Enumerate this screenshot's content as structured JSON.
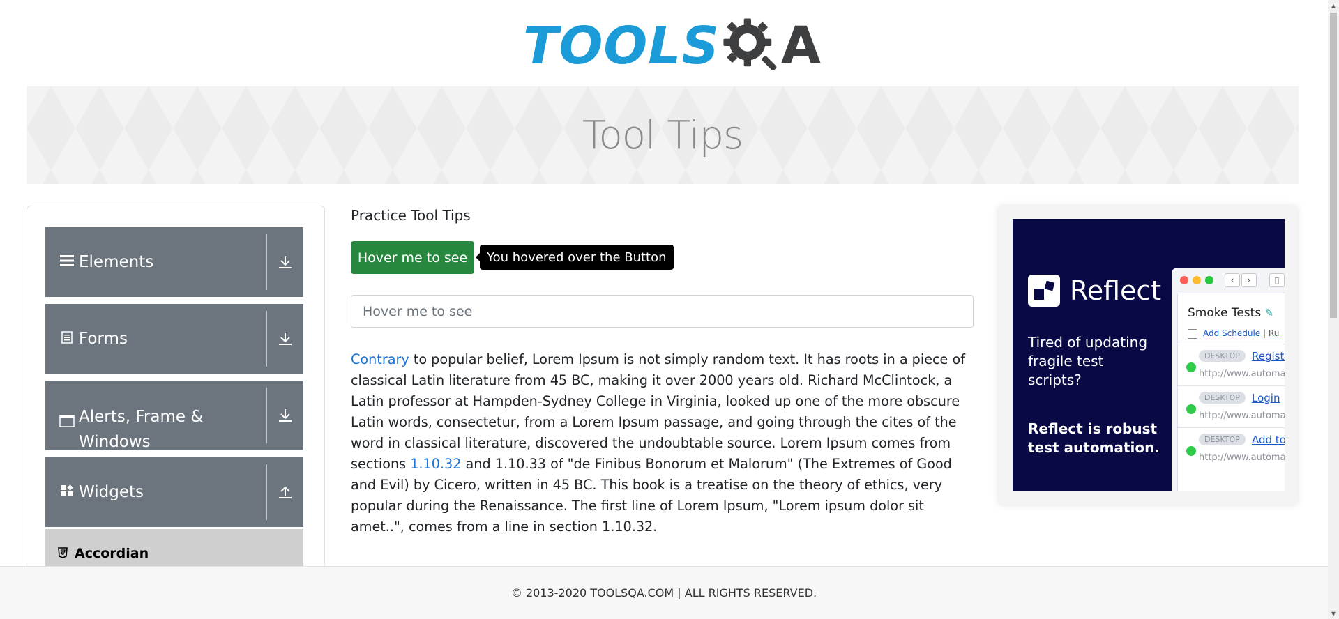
{
  "header": {
    "logo_text_left": "TOOLS",
    "logo_text_right": "A"
  },
  "banner": {
    "title": "Tool Tips"
  },
  "sidebar": {
    "groups": [
      {
        "label": "Elements",
        "icon": "hamburger-icon"
      },
      {
        "label": "Forms",
        "icon": "document-icon"
      },
      {
        "label": "Alerts, Frame &",
        "label2": "Windows",
        "icon": "window-icon"
      },
      {
        "label": "Widgets",
        "icon": "widgets-icon"
      }
    ],
    "sub_items": [
      {
        "label": "Accordian",
        "icon": "html5-icon"
      }
    ]
  },
  "main": {
    "title": "Practice Tool Tips",
    "button_label": "Hover me to see",
    "tooltip_text": "You hovered over the Button",
    "input_placeholder": "Hover me to see",
    "para": {
      "link1": "Contrary",
      "text1": " to popular belief, Lorem Ipsum is not simply random text. It has roots in a piece of classical Latin literature from 45 BC, making it over 2000 years old. Richard McClintock, a Latin professor at Hampden-Sydney College in Virginia, looked up one of the more obscure Latin words, consectetur, from a Lorem Ipsum passage, and going through the cites of the word in classical literature, discovered the undoubtable source. Lorem Ipsum comes from sections ",
      "link2": "1.10.32",
      "text2": " and 1.10.33 of \"de Finibus Bonorum et Malorum\" (The Extremes of Good and Evil) by Cicero, written in 45 BC. This book is a treatise on the theory of ethics, very popular during the Renaissance. The first line of Lorem Ipsum, \"Lorem ipsum dolor sit amet..\", comes from a line in section 1.10.32."
    }
  },
  "ad": {
    "brand": "Reflect",
    "line1": "Tired of updating fragile test scripts?",
    "line2": "Reflect is robust test automation.",
    "panel_title": "Smoke Tests",
    "schedule_link": "Add Schedule",
    "schedule_sep": "| Ru",
    "rows": [
      {
        "tag": "DESKTOP",
        "link": "Registr",
        "url": "http://www.automat"
      },
      {
        "tag": "DESKTOP",
        "link": "Login",
        "url": "http://www.automat"
      },
      {
        "tag": "DESKTOP",
        "link": "Add to",
        "url": "http://www.automat"
      }
    ]
  },
  "footer": {
    "text": "© 2013-2020 TOOLSQA.COM | ALL RIGHTS RESERVED."
  },
  "colors": {
    "logo_blue": "#1b9bd7",
    "logo_dark": "#3e3f40",
    "group_bg": "#6c757d",
    "button_green": "#28873f",
    "link_blue": "#1b73d6",
    "ad_bg": "#090a45"
  }
}
